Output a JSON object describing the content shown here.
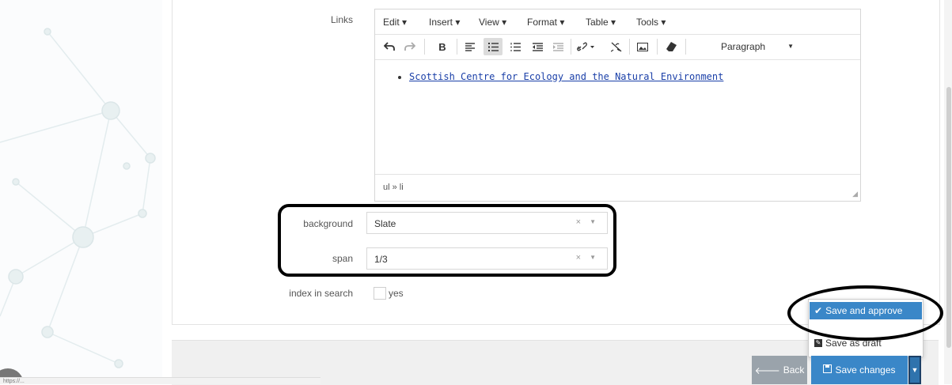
{
  "form": {
    "links_label": "Links",
    "background_label": "background",
    "background_value": "Slate",
    "span_label": "span",
    "span_value": "1/3",
    "index_label": "index in search",
    "index_checkbox_label": "yes"
  },
  "editor": {
    "menus": [
      "Edit ▾",
      "Insert ▾",
      "View ▾",
      "Format ▾",
      "Table ▾",
      "Tools ▾"
    ],
    "toolbar_icons": [
      "undo-icon",
      "redo-icon",
      "bold-icon",
      "align-left-icon",
      "bullet-list-icon",
      "numbered-list-icon",
      "outdent-icon",
      "indent-icon",
      "link-icon",
      "unlink-icon",
      "image-icon",
      "clear-format-icon"
    ],
    "bold_glyph": "B",
    "format_select": "Paragraph",
    "link_text": "Scottish Centre for Ecology and the Natural Environment",
    "element_path": "ul » li"
  },
  "select_controls": {
    "clear": "×",
    "arrow": "▼"
  },
  "dropdown": {
    "save_and_approve": "Save and approve",
    "save_as_draft": "Save as draft"
  },
  "actions": {
    "back": "Back",
    "save_changes": "Save changes",
    "caret": "▼"
  },
  "status_url": "https://...",
  "colors": {
    "primary": "#3a87c8",
    "secondary": "#9aa3ab",
    "link": "#1a3fa8",
    "highlight": "#000000"
  }
}
